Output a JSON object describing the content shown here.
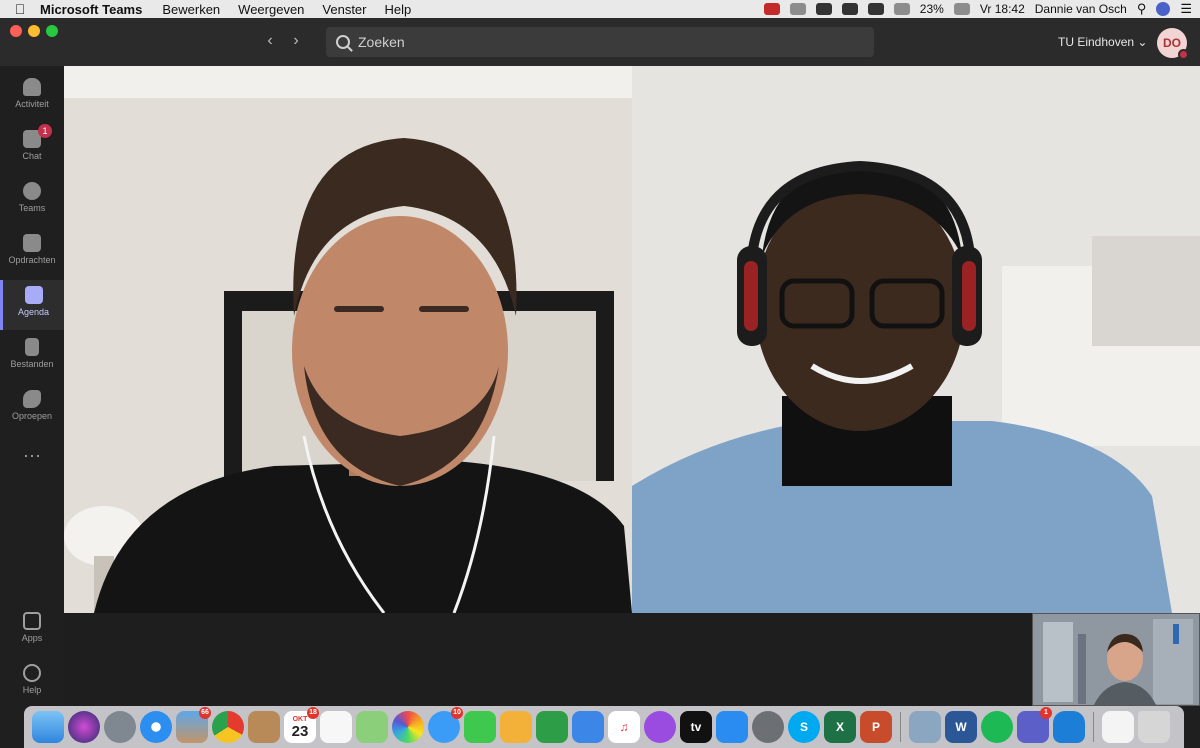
{
  "menubar": {
    "app_name": "Microsoft Teams",
    "menus": [
      "Bewerken",
      "Weergeven",
      "Venster",
      "Help"
    ],
    "battery": "23%",
    "clock": "Vr 18:42",
    "user": "Dannie van Osch"
  },
  "toolbar": {
    "search_placeholder": "Zoeken",
    "org_name": "TU Eindhoven",
    "avatar_initials": "DO"
  },
  "sidebar": {
    "items": [
      {
        "label": "Activiteit",
        "icon": "bell-icon"
      },
      {
        "label": "Chat",
        "icon": "chat-icon",
        "badge": "1"
      },
      {
        "label": "Teams",
        "icon": "teams-icon"
      },
      {
        "label": "Opdrachten",
        "icon": "assignments-icon"
      },
      {
        "label": "Agenda",
        "icon": "calendar-icon",
        "active": true
      },
      {
        "label": "Bestanden",
        "icon": "files-icon"
      },
      {
        "label": "Oproepen",
        "icon": "phone-icon"
      }
    ],
    "bottom": [
      {
        "label": "Apps",
        "icon": "apps-icon"
      },
      {
        "label": "Help",
        "icon": "help-icon"
      }
    ]
  },
  "dock": {
    "badges": {
      "mail": "66",
      "calendar_month": "OKT",
      "calendar_day": "23",
      "calendar_badge": "18",
      "messages": "10",
      "teams": "1"
    },
    "labels": {
      "word": "W",
      "excel": "X",
      "powerpoint": "P",
      "skype": "S",
      "appletv": "tv"
    }
  },
  "colors": {
    "accent": "#7f85f5",
    "presence_busy": "#c4314b"
  }
}
